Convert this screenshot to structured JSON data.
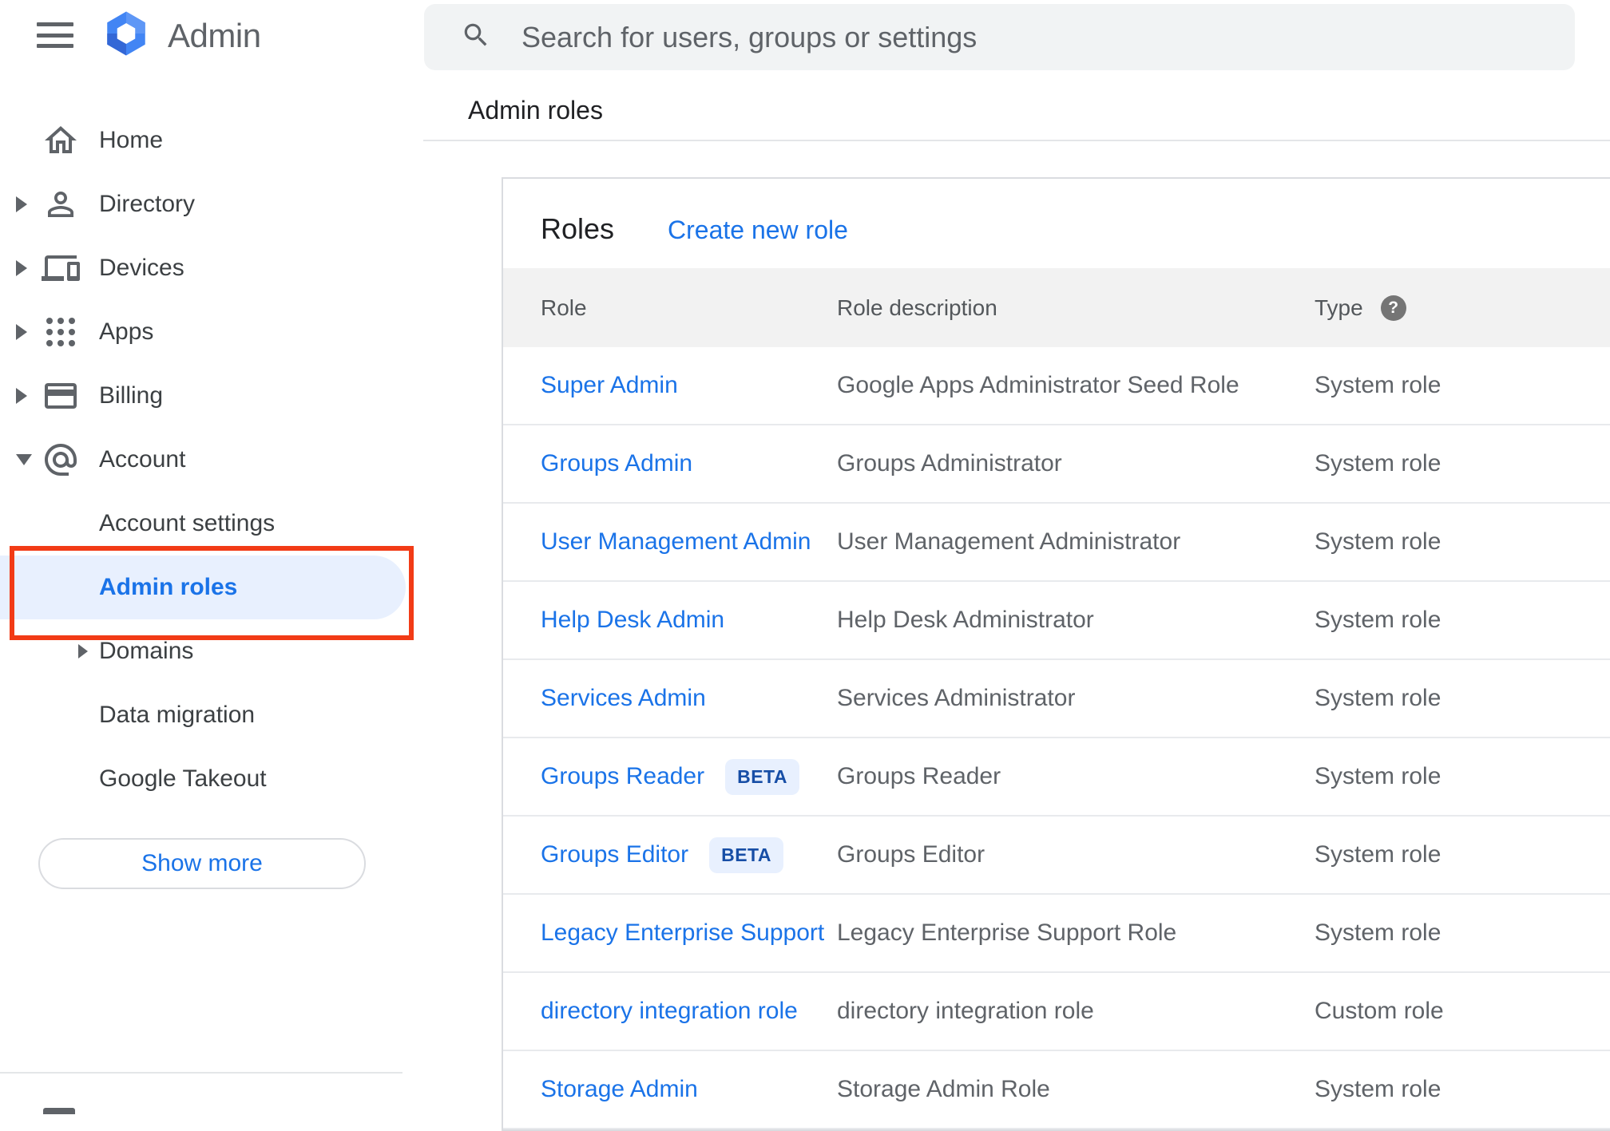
{
  "header": {
    "product_name": "Admin",
    "search_placeholder": "Search for users, groups or settings",
    "breadcrumb": "Admin roles"
  },
  "sidebar": {
    "items": [
      {
        "label": "Home",
        "icon": "home-icon",
        "expandable": false
      },
      {
        "label": "Directory",
        "icon": "person-icon",
        "expandable": true
      },
      {
        "label": "Devices",
        "icon": "devices-icon",
        "expandable": true
      },
      {
        "label": "Apps",
        "icon": "apps-grid-icon",
        "expandable": true
      },
      {
        "label": "Billing",
        "icon": "credit-card-icon",
        "expandable": true
      },
      {
        "label": "Account",
        "icon": "at-sign-icon",
        "expandable": true,
        "expanded": true
      }
    ],
    "account_children": [
      {
        "label": "Account settings"
      },
      {
        "label": "Admin roles",
        "selected": true,
        "annotated": true
      },
      {
        "label": "Domains",
        "expandable": true
      },
      {
        "label": "Data migration"
      },
      {
        "label": "Google Takeout"
      }
    ],
    "show_more_label": "Show more"
  },
  "main": {
    "title": "Roles",
    "create_link": "Create new role",
    "table": {
      "columns": [
        "Role",
        "Role description",
        "Type"
      ],
      "help_icon": "?",
      "rows": [
        {
          "role": "Super Admin",
          "description": "Google Apps Administrator Seed Role",
          "type": "System role"
        },
        {
          "role": "Groups Admin",
          "description": "Groups Administrator",
          "type": "System role"
        },
        {
          "role": "User Management Admin",
          "description": "User Management Administrator",
          "type": "System role"
        },
        {
          "role": "Help Desk Admin",
          "description": "Help Desk Administrator",
          "type": "System role"
        },
        {
          "role": "Services Admin",
          "description": "Services Administrator",
          "type": "System role"
        },
        {
          "role": "Groups Reader",
          "badge": "BETA",
          "description": "Groups Reader",
          "type": "System role"
        },
        {
          "role": "Groups Editor",
          "badge": "BETA",
          "description": "Groups Editor",
          "type": "System role"
        },
        {
          "role": "Legacy Enterprise Support",
          "description": "Legacy Enterprise Support Role",
          "type": "System role"
        },
        {
          "role": "directory integration role",
          "description": "directory integration role",
          "type": "Custom role"
        },
        {
          "role": "Storage Admin",
          "description": "Storage Admin Role",
          "type": "System role"
        }
      ]
    }
  },
  "colors": {
    "accent_blue": "#1a73e8",
    "annotation_red": "#f23b16",
    "selected_item_bg": "#e8f0fe",
    "beta_badge_bg": "#e8f0fe",
    "beta_badge_text": "#174ea6",
    "table_header_bg": "#f2f2f2",
    "icon_gray": "#5f6368"
  }
}
